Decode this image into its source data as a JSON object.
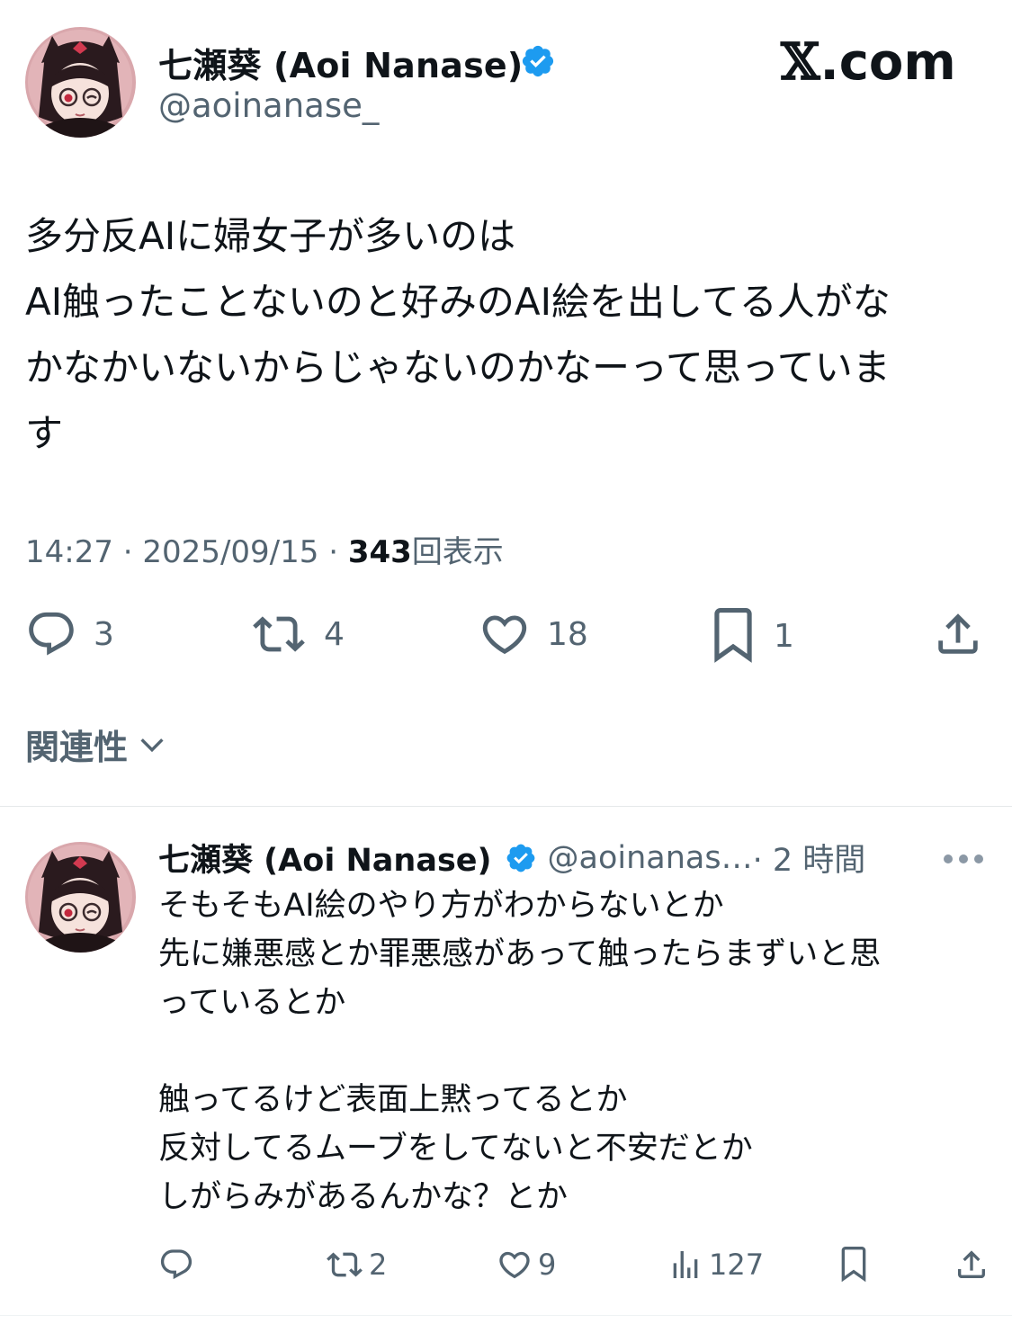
{
  "brand": {
    "prefix": "𝕏",
    "suffix": ".com"
  },
  "main_tweet": {
    "author_name": "七瀬葵 (Aoi Nanase)",
    "handle": "@aoinanase_",
    "verified_icon": "verified-badge-icon",
    "body_lines": [
      "多分反AIに婦女子が多いのは",
      "AI触ったことないのと好みのAI絵を出してる人がな",
      "かなかいないからじゃないのかなーって思っていま",
      "す"
    ],
    "time": "14:27",
    "date": "2025/09/15",
    "views": "343",
    "views_label": "回表示",
    "separator": "·",
    "actions": {
      "reply_count": "3",
      "retweet_count": "4",
      "like_count": "18",
      "bookmark_count": "1"
    }
  },
  "related": {
    "label": "関連性"
  },
  "reply_tweet": {
    "author_name": "七瀬葵 (Aoi Nanase)",
    "handle": "@aoinanas…",
    "time": "· 2 時間",
    "more_icon": "more-dots-icon",
    "body_lines": [
      "そもそもAI絵のやり方がわからないとか",
      "先に嫌悪感とか罪悪感があって触ったらまずいと思",
      "っているとか",
      "",
      "触ってるけど表面上黙ってるとか",
      "反対してるムーブをしてないと不安だとか",
      "しがらみがあるんかな？とか"
    ],
    "actions": {
      "reply_count": "",
      "retweet_count": "2",
      "like_count": "9",
      "views_count": "127"
    }
  },
  "colors": {
    "text": "#0f1419",
    "muted": "#536471",
    "verified": "#1d9bf0",
    "divider": "#e6e9ea"
  }
}
